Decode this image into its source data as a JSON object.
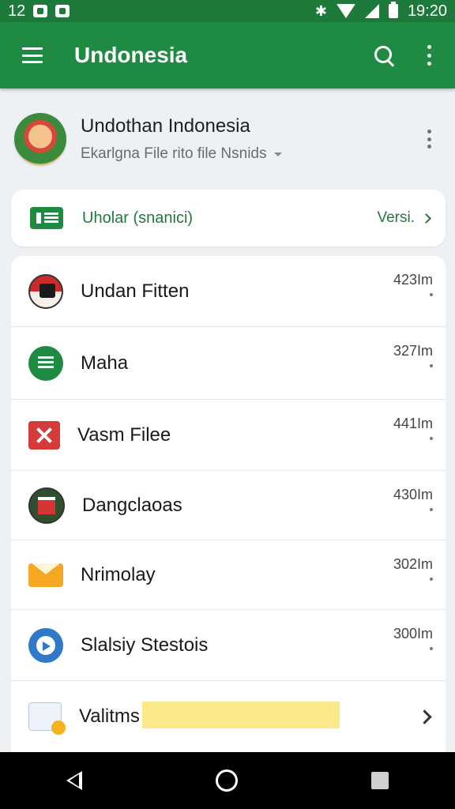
{
  "status_bar": {
    "left_text": "12",
    "time": "19:20"
  },
  "app_bar": {
    "title": "Undonesia",
    "icons": [
      "menu-icon",
      "search-icon",
      "more-vert-icon"
    ]
  },
  "profile": {
    "name": "Undothan Indonesia",
    "subtitle": "Ekarlgna File rito file Nsnids"
  },
  "storage_card": {
    "label": "Uholar (snanici)",
    "link": "Versi."
  },
  "files": [
    {
      "name": "Undan Fitten",
      "meta": "423Im",
      "icon": "flag-icon"
    },
    {
      "name": "Maha",
      "meta": "327Im",
      "icon": "list-icon"
    },
    {
      "name": "Vasm Filee",
      "meta": "441Im",
      "icon": "close-x-icon"
    },
    {
      "name": "Dangclaoas",
      "meta": "430Im",
      "icon": "document-icon"
    },
    {
      "name": "Nrimolay",
      "meta": "302Im",
      "icon": "mail-icon"
    },
    {
      "name": "Slalsiy Stestois",
      "meta": "300Im",
      "icon": "chat-icon"
    },
    {
      "name": "Valitms",
      "meta": "",
      "icon": "calendar-icon"
    }
  ],
  "colors": {
    "app_bar": "#1f8a42",
    "status_bar": "#1d7a3a",
    "accent_text": "#1f7a3a",
    "highlight": "#fbe88b"
  }
}
